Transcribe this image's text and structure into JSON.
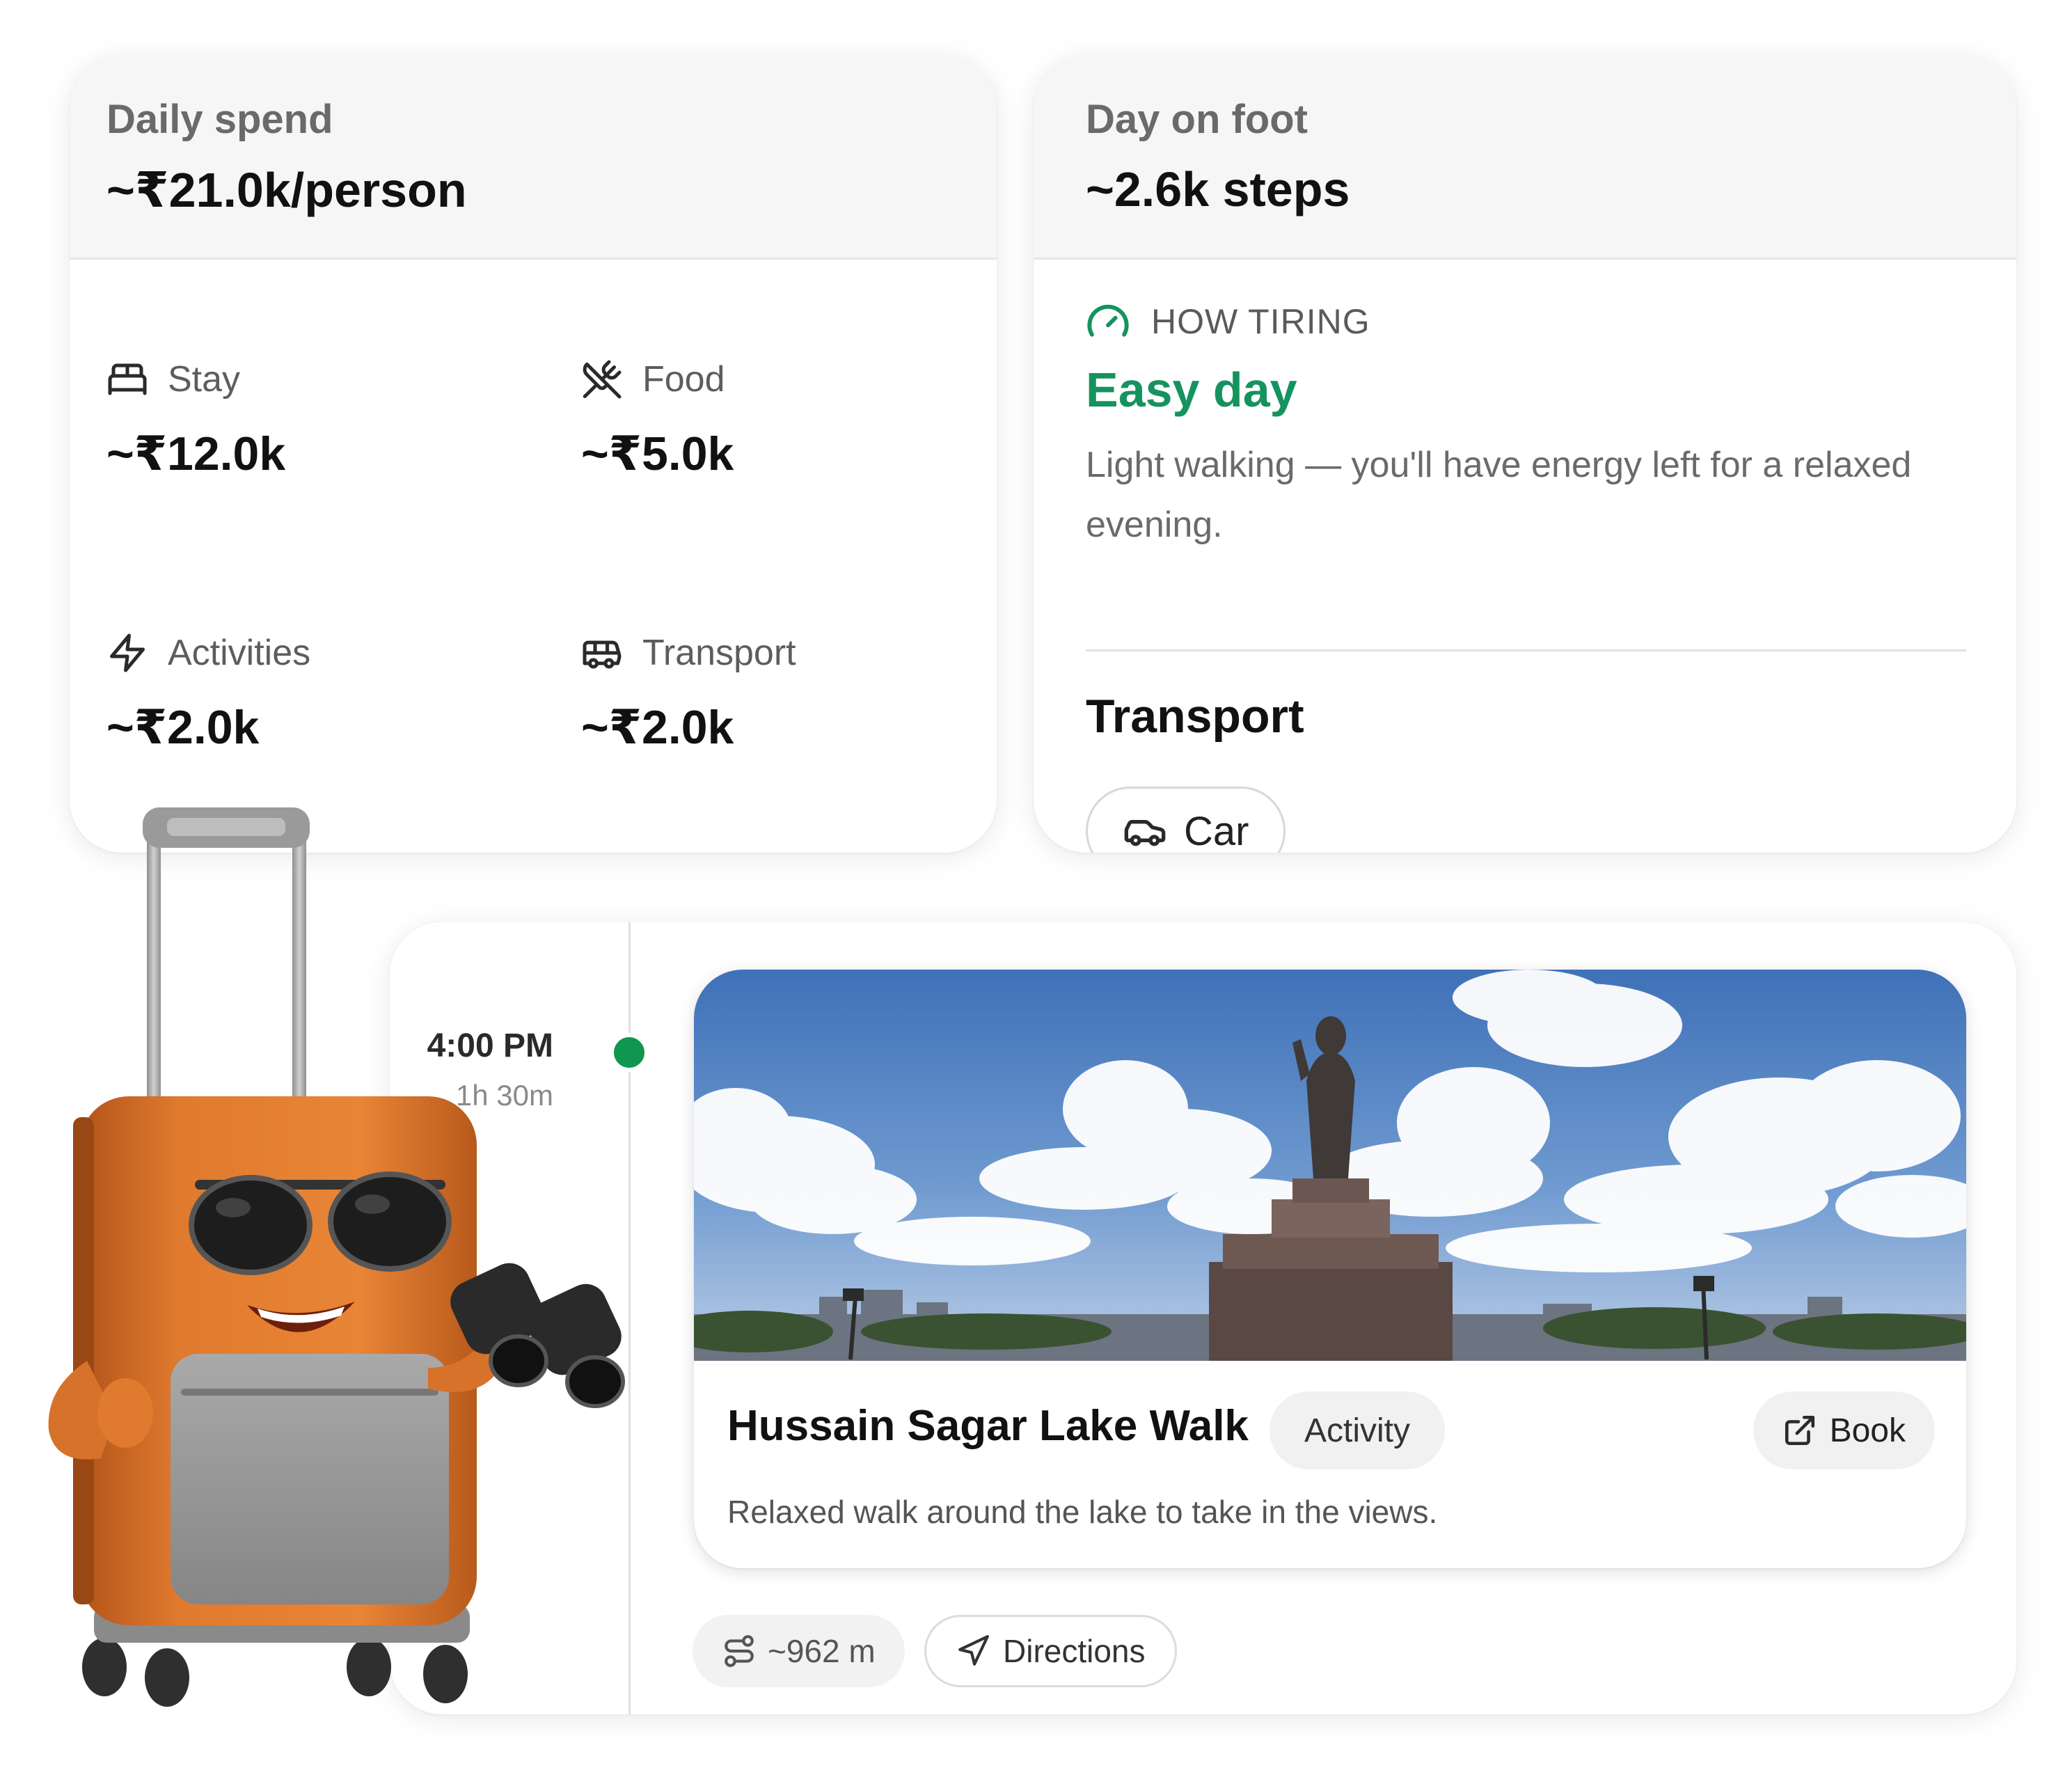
{
  "spend": {
    "label": "Daily spend",
    "value": "~₹21.0k/person",
    "items": [
      {
        "icon": "bed-icon",
        "label": "Stay",
        "value": "~₹12.0k"
      },
      {
        "icon": "utensils-crossed-icon",
        "label": "Food",
        "value": "~₹5.0k"
      },
      {
        "icon": "lightning-icon",
        "label": "Activities",
        "value": "~₹2.0k"
      },
      {
        "icon": "bus-icon",
        "label": "Transport",
        "value": "~₹2.0k"
      }
    ]
  },
  "foot": {
    "label": "Day on foot",
    "value": "~2.6k steps",
    "tiring_label": "HOW TIRING",
    "tiring_value": "Easy day",
    "tiring_desc": "Light walking — you'll have energy left for a relaxed evening.",
    "transport_title": "Transport",
    "transport_mode": "Car"
  },
  "timeline": {
    "time": "4:00 PM",
    "duration": "1h 30m",
    "activity": {
      "title": "Hussain Sagar Lake Walk",
      "tag": "Activity",
      "book_label": "Book",
      "description": "Relaxed walk around the lake to take in the views."
    },
    "distance": "~962 m",
    "directions_label": "Directions"
  },
  "colors": {
    "accent_green": "#15935e",
    "dot_green": "#119650",
    "head_bg": "#f6f6f6"
  }
}
